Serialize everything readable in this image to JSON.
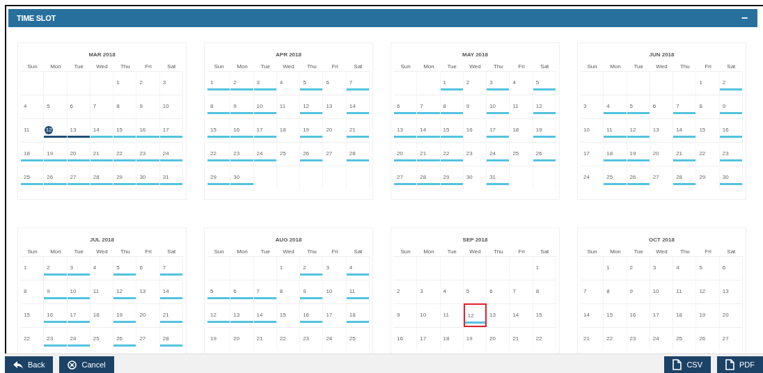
{
  "panel": {
    "title": "TIME SLOT",
    "collapse_icon": "−"
  },
  "months": [
    {
      "title": "MAR 2018",
      "weekdays": [
        "Sun",
        "Mon",
        "Tue",
        "Wed",
        "Thu",
        "Fri",
        "Sat"
      ],
      "weeks": [
        [
          {
            "day": "1",
            "kind": "plain",
            "selected": false,
            "outlined": false
          },
          {
            "day": "2",
            "kind": "plain",
            "selected": false,
            "outlined": false
          },
          {
            "day": "3",
            "kind": "plain",
            "selected": false,
            "outlined": false
          }
        ],
        [
          {
            "day": "4",
            "kind": "plain",
            "selected": false,
            "outlined": false
          },
          {
            "day": "5",
            "kind": "plain",
            "selected": false,
            "outlined": false
          },
          {
            "day": "6",
            "kind": "plain",
            "selected": false,
            "outlined": false
          },
          {
            "day": "7",
            "kind": "plain",
            "selected": false,
            "outlined": false
          },
          {
            "day": "8",
            "kind": "plain",
            "selected": false,
            "outlined": false
          },
          {
            "day": "9",
            "kind": "plain",
            "selected": false,
            "outlined": false
          },
          {
            "day": "10",
            "kind": "plain",
            "selected": false,
            "outlined": false
          }
        ],
        [
          {
            "day": "11",
            "kind": "plain",
            "selected": false,
            "outlined": false
          },
          {
            "day": "12",
            "kind": "booked",
            "selected": true,
            "outlined": false
          },
          {
            "day": "13",
            "kind": "booked",
            "selected": false,
            "outlined": false
          },
          {
            "day": "14",
            "kind": "open",
            "selected": false,
            "outlined": false
          },
          {
            "day": "15",
            "kind": "open",
            "selected": false,
            "outlined": false
          },
          {
            "day": "16",
            "kind": "open",
            "selected": false,
            "outlined": false
          },
          {
            "day": "17",
            "kind": "open",
            "selected": false,
            "outlined": false
          }
        ],
        [
          {
            "day": "18",
            "kind": "open",
            "selected": false,
            "outlined": false
          },
          {
            "day": "19",
            "kind": "open",
            "selected": false,
            "outlined": false
          },
          {
            "day": "20",
            "kind": "open",
            "selected": false,
            "outlined": false
          },
          {
            "day": "21",
            "kind": "open",
            "selected": false,
            "outlined": false
          },
          {
            "day": "22",
            "kind": "open",
            "selected": false,
            "outlined": false
          },
          {
            "day": "23",
            "kind": "open",
            "selected": false,
            "outlined": false
          },
          {
            "day": "24",
            "kind": "open",
            "selected": false,
            "outlined": false
          }
        ],
        [
          {
            "day": "25",
            "kind": "open",
            "selected": false,
            "outlined": false
          },
          {
            "day": "26",
            "kind": "open",
            "selected": false,
            "outlined": false
          },
          {
            "day": "27",
            "kind": "open",
            "selected": false,
            "outlined": false
          },
          {
            "day": "28",
            "kind": "open",
            "selected": false,
            "outlined": false
          },
          {
            "day": "29",
            "kind": "open",
            "selected": false,
            "outlined": false
          },
          {
            "day": "30",
            "kind": "open",
            "selected": false,
            "outlined": false
          },
          {
            "day": "31",
            "kind": "open",
            "selected": false,
            "outlined": false
          }
        ]
      ]
    },
    {
      "title": "APR 2018",
      "weekdays": [
        "Sun",
        "Mon",
        "Tue",
        "Wed",
        "Thu",
        "Fri",
        "Sat"
      ],
      "weeks": [
        [
          {
            "day": "1",
            "kind": "open",
            "selected": false,
            "outlined": false
          },
          {
            "day": "2",
            "kind": "open",
            "selected": false,
            "outlined": false
          },
          {
            "day": "3",
            "kind": "open",
            "selected": false,
            "outlined": false
          },
          {
            "day": "4",
            "kind": "plain",
            "selected": false,
            "outlined": false
          },
          {
            "day": "5",
            "kind": "open",
            "selected": false,
            "outlined": false
          },
          {
            "day": "6",
            "kind": "plain",
            "selected": false,
            "outlined": false
          },
          {
            "day": "7",
            "kind": "open",
            "selected": false,
            "outlined": false
          }
        ],
        [
          {
            "day": "8",
            "kind": "open",
            "selected": false,
            "outlined": false
          },
          {
            "day": "9",
            "kind": "open",
            "selected": false,
            "outlined": false
          },
          {
            "day": "10",
            "kind": "open",
            "selected": false,
            "outlined": false
          },
          {
            "day": "11",
            "kind": "plain",
            "selected": false,
            "outlined": false
          },
          {
            "day": "12",
            "kind": "open",
            "selected": false,
            "outlined": false
          },
          {
            "day": "13",
            "kind": "plain",
            "selected": false,
            "outlined": false
          },
          {
            "day": "14",
            "kind": "open",
            "selected": false,
            "outlined": false
          }
        ],
        [
          {
            "day": "15",
            "kind": "open",
            "selected": false,
            "outlined": false
          },
          {
            "day": "16",
            "kind": "open",
            "selected": false,
            "outlined": false
          },
          {
            "day": "17",
            "kind": "open",
            "selected": false,
            "outlined": false
          },
          {
            "day": "18",
            "kind": "plain",
            "selected": false,
            "outlined": false
          },
          {
            "day": "19",
            "kind": "open",
            "selected": false,
            "outlined": false
          },
          {
            "day": "20",
            "kind": "plain",
            "selected": false,
            "outlined": false
          },
          {
            "day": "21",
            "kind": "open",
            "selected": false,
            "outlined": false
          }
        ],
        [
          {
            "day": "22",
            "kind": "open",
            "selected": false,
            "outlined": false
          },
          {
            "day": "23",
            "kind": "open",
            "selected": false,
            "outlined": false
          },
          {
            "day": "24",
            "kind": "open",
            "selected": false,
            "outlined": false
          },
          {
            "day": "25",
            "kind": "plain",
            "selected": false,
            "outlined": false
          },
          {
            "day": "26",
            "kind": "open",
            "selected": false,
            "outlined": false
          },
          {
            "day": "27",
            "kind": "plain",
            "selected": false,
            "outlined": false
          },
          {
            "day": "28",
            "kind": "open",
            "selected": false,
            "outlined": false
          }
        ],
        [
          {
            "day": "29",
            "kind": "open",
            "selected": false,
            "outlined": false
          },
          {
            "day": "30",
            "kind": "open",
            "selected": false,
            "outlined": false
          }
        ]
      ]
    },
    {
      "title": "MAY 2018",
      "weekdays": [
        "Sun",
        "Mon",
        "Tue",
        "Wed",
        "Thu",
        "Fri",
        "Sat"
      ],
      "weeks": [
        [
          {
            "day": "1",
            "kind": "open",
            "selected": false,
            "outlined": false
          },
          {
            "day": "2",
            "kind": "plain",
            "selected": false,
            "outlined": false
          },
          {
            "day": "3",
            "kind": "open",
            "selected": false,
            "outlined": false
          },
          {
            "day": "4",
            "kind": "plain",
            "selected": false,
            "outlined": false
          },
          {
            "day": "5",
            "kind": "open",
            "selected": false,
            "outlined": false
          }
        ],
        [
          {
            "day": "6",
            "kind": "open",
            "selected": false,
            "outlined": false
          },
          {
            "day": "7",
            "kind": "open",
            "selected": false,
            "outlined": false
          },
          {
            "day": "8",
            "kind": "open",
            "selected": false,
            "outlined": false
          },
          {
            "day": "9",
            "kind": "plain",
            "selected": false,
            "outlined": false
          },
          {
            "day": "10",
            "kind": "open",
            "selected": false,
            "outlined": false
          },
          {
            "day": "11",
            "kind": "plain",
            "selected": false,
            "outlined": false
          },
          {
            "day": "12",
            "kind": "open",
            "selected": false,
            "outlined": false
          }
        ],
        [
          {
            "day": "13",
            "kind": "open",
            "selected": false,
            "outlined": false
          },
          {
            "day": "14",
            "kind": "open",
            "selected": false,
            "outlined": false
          },
          {
            "day": "15",
            "kind": "open",
            "selected": false,
            "outlined": false
          },
          {
            "day": "16",
            "kind": "plain",
            "selected": false,
            "outlined": false
          },
          {
            "day": "17",
            "kind": "open",
            "selected": false,
            "outlined": false
          },
          {
            "day": "18",
            "kind": "plain",
            "selected": false,
            "outlined": false
          },
          {
            "day": "19",
            "kind": "open",
            "selected": false,
            "outlined": false
          }
        ],
        [
          {
            "day": "20",
            "kind": "open",
            "selected": false,
            "outlined": false
          },
          {
            "day": "21",
            "kind": "open",
            "selected": false,
            "outlined": false
          },
          {
            "day": "22",
            "kind": "open",
            "selected": false,
            "outlined": false
          },
          {
            "day": "23",
            "kind": "plain",
            "selected": false,
            "outlined": false
          },
          {
            "day": "24",
            "kind": "open",
            "selected": false,
            "outlined": false
          },
          {
            "day": "25",
            "kind": "plain",
            "selected": false,
            "outlined": false
          },
          {
            "day": "26",
            "kind": "open",
            "selected": false,
            "outlined": false
          }
        ],
        [
          {
            "day": "27",
            "kind": "open",
            "selected": false,
            "outlined": false
          },
          {
            "day": "28",
            "kind": "open",
            "selected": false,
            "outlined": false
          },
          {
            "day": "29",
            "kind": "open",
            "selected": false,
            "outlined": false
          },
          {
            "day": "30",
            "kind": "plain",
            "selected": false,
            "outlined": false
          },
          {
            "day": "31",
            "kind": "open",
            "selected": false,
            "outlined": false
          }
        ]
      ]
    },
    {
      "title": "JUN 2018",
      "weekdays": [
        "Sun",
        "Mon",
        "Tue",
        "Wed",
        "Thu",
        "Fri",
        "Sat"
      ],
      "weeks": [
        [
          {
            "day": "1",
            "kind": "plain",
            "selected": false,
            "outlined": false
          },
          {
            "day": "2",
            "kind": "open",
            "selected": false,
            "outlined": false
          }
        ],
        [
          {
            "day": "3",
            "kind": "plain",
            "selected": false,
            "outlined": false
          },
          {
            "day": "4",
            "kind": "open",
            "selected": false,
            "outlined": false
          },
          {
            "day": "5",
            "kind": "open",
            "selected": false,
            "outlined": false
          },
          {
            "day": "6",
            "kind": "plain",
            "selected": false,
            "outlined": false
          },
          {
            "day": "7",
            "kind": "open",
            "selected": false,
            "outlined": false
          },
          {
            "day": "8",
            "kind": "plain",
            "selected": false,
            "outlined": false
          },
          {
            "day": "9",
            "kind": "open",
            "selected": false,
            "outlined": false
          }
        ],
        [
          {
            "day": "10",
            "kind": "plain",
            "selected": false,
            "outlined": false
          },
          {
            "day": "11",
            "kind": "open",
            "selected": false,
            "outlined": false
          },
          {
            "day": "12",
            "kind": "open",
            "selected": false,
            "outlined": false
          },
          {
            "day": "13",
            "kind": "plain",
            "selected": false,
            "outlined": false
          },
          {
            "day": "14",
            "kind": "open",
            "selected": false,
            "outlined": false
          },
          {
            "day": "15",
            "kind": "plain",
            "selected": false,
            "outlined": false
          },
          {
            "day": "16",
            "kind": "open",
            "selected": false,
            "outlined": false
          }
        ],
        [
          {
            "day": "17",
            "kind": "plain",
            "selected": false,
            "outlined": false
          },
          {
            "day": "18",
            "kind": "open",
            "selected": false,
            "outlined": false
          },
          {
            "day": "19",
            "kind": "open",
            "selected": false,
            "outlined": false
          },
          {
            "day": "20",
            "kind": "plain",
            "selected": false,
            "outlined": false
          },
          {
            "day": "21",
            "kind": "open",
            "selected": false,
            "outlined": false
          },
          {
            "day": "22",
            "kind": "plain",
            "selected": false,
            "outlined": false
          },
          {
            "day": "23",
            "kind": "open",
            "selected": false,
            "outlined": false
          }
        ],
        [
          {
            "day": "24",
            "kind": "plain",
            "selected": false,
            "outlined": false
          },
          {
            "day": "25",
            "kind": "open",
            "selected": false,
            "outlined": false
          },
          {
            "day": "26",
            "kind": "open",
            "selected": false,
            "outlined": false
          },
          {
            "day": "27",
            "kind": "plain",
            "selected": false,
            "outlined": false
          },
          {
            "day": "28",
            "kind": "open",
            "selected": false,
            "outlined": false
          },
          {
            "day": "29",
            "kind": "plain",
            "selected": false,
            "outlined": false
          },
          {
            "day": "30",
            "kind": "open",
            "selected": false,
            "outlined": false
          }
        ]
      ]
    },
    {
      "title": "JUL 2018",
      "weekdays": [
        "Sun",
        "Mon",
        "Tue",
        "Wed",
        "Thu",
        "Fri",
        "Sat"
      ],
      "weeks": [
        [
          {
            "day": "1",
            "kind": "plain",
            "selected": false,
            "outlined": false
          },
          {
            "day": "2",
            "kind": "open",
            "selected": false,
            "outlined": false
          },
          {
            "day": "3",
            "kind": "open",
            "selected": false,
            "outlined": false
          },
          {
            "day": "4",
            "kind": "plain",
            "selected": false,
            "outlined": false
          },
          {
            "day": "5",
            "kind": "open",
            "selected": false,
            "outlined": false
          },
          {
            "day": "6",
            "kind": "plain",
            "selected": false,
            "outlined": false
          },
          {
            "day": "7",
            "kind": "open",
            "selected": false,
            "outlined": false
          }
        ],
        [
          {
            "day": "8",
            "kind": "plain",
            "selected": false,
            "outlined": false
          },
          {
            "day": "9",
            "kind": "open",
            "selected": false,
            "outlined": false
          },
          {
            "day": "10",
            "kind": "open",
            "selected": false,
            "outlined": false
          },
          {
            "day": "11",
            "kind": "plain",
            "selected": false,
            "outlined": false
          },
          {
            "day": "12",
            "kind": "open",
            "selected": false,
            "outlined": false
          },
          {
            "day": "13",
            "kind": "plain",
            "selected": false,
            "outlined": false
          },
          {
            "day": "14",
            "kind": "open",
            "selected": false,
            "outlined": false
          }
        ],
        [
          {
            "day": "15",
            "kind": "plain",
            "selected": false,
            "outlined": false
          },
          {
            "day": "16",
            "kind": "open",
            "selected": false,
            "outlined": false
          },
          {
            "day": "17",
            "kind": "open",
            "selected": false,
            "outlined": false
          },
          {
            "day": "18",
            "kind": "plain",
            "selected": false,
            "outlined": false
          },
          {
            "day": "19",
            "kind": "open",
            "selected": false,
            "outlined": false
          },
          {
            "day": "20",
            "kind": "plain",
            "selected": false,
            "outlined": false
          },
          {
            "day": "21",
            "kind": "open",
            "selected": false,
            "outlined": false
          }
        ],
        [
          {
            "day": "22",
            "kind": "plain",
            "selected": false,
            "outlined": false
          },
          {
            "day": "23",
            "kind": "open",
            "selected": false,
            "outlined": false
          },
          {
            "day": "24",
            "kind": "open",
            "selected": false,
            "outlined": false
          },
          {
            "day": "25",
            "kind": "plain",
            "selected": false,
            "outlined": false
          },
          {
            "day": "26",
            "kind": "open",
            "selected": false,
            "outlined": false
          },
          {
            "day": "27",
            "kind": "plain",
            "selected": false,
            "outlined": false
          },
          {
            "day": "28",
            "kind": "open",
            "selected": false,
            "outlined": false
          }
        ]
      ]
    },
    {
      "title": "AUG 2018",
      "weekdays": [
        "Sun",
        "Mon",
        "Tue",
        "Wed",
        "Thu",
        "Fri",
        "Sat"
      ],
      "weeks": [
        [
          {
            "day": "1",
            "kind": "plain",
            "selected": false,
            "outlined": false
          },
          {
            "day": "2",
            "kind": "open",
            "selected": false,
            "outlined": false
          },
          {
            "day": "3",
            "kind": "plain",
            "selected": false,
            "outlined": false
          },
          {
            "day": "4",
            "kind": "open",
            "selected": false,
            "outlined": false
          }
        ],
        [
          {
            "day": "5",
            "kind": "open",
            "selected": false,
            "outlined": false
          },
          {
            "day": "6",
            "kind": "open",
            "selected": false,
            "outlined": false
          },
          {
            "day": "7",
            "kind": "open",
            "selected": false,
            "outlined": false
          },
          {
            "day": "8",
            "kind": "plain",
            "selected": false,
            "outlined": false
          },
          {
            "day": "9",
            "kind": "open",
            "selected": false,
            "outlined": false
          },
          {
            "day": "10",
            "kind": "plain",
            "selected": false,
            "outlined": false
          },
          {
            "day": "11",
            "kind": "open",
            "selected": false,
            "outlined": false
          }
        ],
        [
          {
            "day": "12",
            "kind": "open",
            "selected": false,
            "outlined": false
          },
          {
            "day": "13",
            "kind": "open",
            "selected": false,
            "outlined": false
          },
          {
            "day": "14",
            "kind": "open",
            "selected": false,
            "outlined": false
          },
          {
            "day": "15",
            "kind": "plain",
            "selected": false,
            "outlined": false
          },
          {
            "day": "16",
            "kind": "open",
            "selected": false,
            "outlined": false
          },
          {
            "day": "17",
            "kind": "plain",
            "selected": false,
            "outlined": false
          },
          {
            "day": "18",
            "kind": "open",
            "selected": false,
            "outlined": false
          }
        ],
        [
          {
            "day": "19",
            "kind": "plain",
            "selected": false,
            "outlined": false
          },
          {
            "day": "20",
            "kind": "plain",
            "selected": false,
            "outlined": false
          },
          {
            "day": "21",
            "kind": "plain",
            "selected": false,
            "outlined": false
          },
          {
            "day": "22",
            "kind": "plain",
            "selected": false,
            "outlined": false
          },
          {
            "day": "23",
            "kind": "plain",
            "selected": false,
            "outlined": false
          },
          {
            "day": "24",
            "kind": "plain",
            "selected": false,
            "outlined": false
          },
          {
            "day": "25",
            "kind": "plain",
            "selected": false,
            "outlined": false
          }
        ]
      ]
    },
    {
      "title": "SEP 2018",
      "weekdays": [
        "Sun",
        "Mon",
        "Tue",
        "Wed",
        "Thu",
        "Fri",
        "Sat"
      ],
      "weeks": [
        [
          {
            "day": "1",
            "kind": "plain",
            "selected": false,
            "outlined": false
          }
        ],
        [
          {
            "day": "2",
            "kind": "plain",
            "selected": false,
            "outlined": false
          },
          {
            "day": "3",
            "kind": "plain",
            "selected": false,
            "outlined": false
          },
          {
            "day": "4",
            "kind": "plain",
            "selected": false,
            "outlined": false
          },
          {
            "day": "5",
            "kind": "plain",
            "selected": false,
            "outlined": false
          },
          {
            "day": "6",
            "kind": "plain",
            "selected": false,
            "outlined": false
          },
          {
            "day": "7",
            "kind": "plain",
            "selected": false,
            "outlined": false
          },
          {
            "day": "8",
            "kind": "plain",
            "selected": false,
            "outlined": false
          }
        ],
        [
          {
            "day": "9",
            "kind": "plain",
            "selected": false,
            "outlined": false
          },
          {
            "day": "10",
            "kind": "plain",
            "selected": false,
            "outlined": false
          },
          {
            "day": "11",
            "kind": "plain",
            "selected": false,
            "outlined": false
          },
          {
            "day": "12",
            "kind": "open",
            "selected": false,
            "outlined": true
          },
          {
            "day": "13",
            "kind": "plain",
            "selected": false,
            "outlined": false
          },
          {
            "day": "14",
            "kind": "plain",
            "selected": false,
            "outlined": false
          },
          {
            "day": "15",
            "kind": "plain",
            "selected": false,
            "outlined": false
          }
        ],
        [
          {
            "day": "16",
            "kind": "plain",
            "selected": false,
            "outlined": false
          },
          {
            "day": "17",
            "kind": "plain",
            "selected": false,
            "outlined": false
          },
          {
            "day": "18",
            "kind": "plain",
            "selected": false,
            "outlined": false
          },
          {
            "day": "19",
            "kind": "plain",
            "selected": false,
            "outlined": false
          },
          {
            "day": "20",
            "kind": "plain",
            "selected": false,
            "outlined": false
          },
          {
            "day": "21",
            "kind": "plain",
            "selected": false,
            "outlined": false
          },
          {
            "day": "22",
            "kind": "plain",
            "selected": false,
            "outlined": false
          }
        ]
      ]
    },
    {
      "title": "OCT 2018",
      "weekdays": [
        "Sun",
        "Mon",
        "Tue",
        "Wed",
        "Thu",
        "Fri",
        "Sat"
      ],
      "weeks": [
        [
          {
            "day": "1",
            "kind": "plain",
            "selected": false,
            "outlined": false
          },
          {
            "day": "2",
            "kind": "plain",
            "selected": false,
            "outlined": false
          },
          {
            "day": "3",
            "kind": "plain",
            "selected": false,
            "outlined": false
          },
          {
            "day": "4",
            "kind": "plain",
            "selected": false,
            "outlined": false
          },
          {
            "day": "5",
            "kind": "plain",
            "selected": false,
            "outlined": false
          },
          {
            "day": "6",
            "kind": "plain",
            "selected": false,
            "outlined": false
          }
        ],
        [
          {
            "day": "7",
            "kind": "plain",
            "selected": false,
            "outlined": false
          },
          {
            "day": "8",
            "kind": "plain",
            "selected": false,
            "outlined": false
          },
          {
            "day": "9",
            "kind": "plain",
            "selected": false,
            "outlined": false
          },
          {
            "day": "10",
            "kind": "plain",
            "selected": false,
            "outlined": false
          },
          {
            "day": "11",
            "kind": "plain",
            "selected": false,
            "outlined": false
          },
          {
            "day": "12",
            "kind": "plain",
            "selected": false,
            "outlined": false
          },
          {
            "day": "13",
            "kind": "plain",
            "selected": false,
            "outlined": false
          }
        ],
        [
          {
            "day": "14",
            "kind": "plain",
            "selected": false,
            "outlined": false
          },
          {
            "day": "15",
            "kind": "plain",
            "selected": false,
            "outlined": false
          },
          {
            "day": "16",
            "kind": "plain",
            "selected": false,
            "outlined": false
          },
          {
            "day": "17",
            "kind": "plain",
            "selected": false,
            "outlined": false
          },
          {
            "day": "18",
            "kind": "plain",
            "selected": false,
            "outlined": false
          },
          {
            "day": "19",
            "kind": "plain",
            "selected": false,
            "outlined": false
          },
          {
            "day": "20",
            "kind": "plain",
            "selected": false,
            "outlined": false
          }
        ],
        [
          {
            "day": "21",
            "kind": "plain",
            "selected": false,
            "outlined": false
          },
          {
            "day": "22",
            "kind": "plain",
            "selected": false,
            "outlined": false
          },
          {
            "day": "23",
            "kind": "plain",
            "selected": false,
            "outlined": false
          },
          {
            "day": "24",
            "kind": "plain",
            "selected": false,
            "outlined": false
          },
          {
            "day": "25",
            "kind": "plain",
            "selected": false,
            "outlined": false
          },
          {
            "day": "26",
            "kind": "plain",
            "selected": false,
            "outlined": false
          },
          {
            "day": "27",
            "kind": "plain",
            "selected": false,
            "outlined": false
          }
        ]
      ]
    }
  ],
  "footer": {
    "left_buttons": [
      {
        "label": "Back"
      },
      {
        "label": "Cancel"
      }
    ],
    "right_buttons": [
      {
        "label": "CSV"
      },
      {
        "label": "PDF"
      }
    ]
  }
}
